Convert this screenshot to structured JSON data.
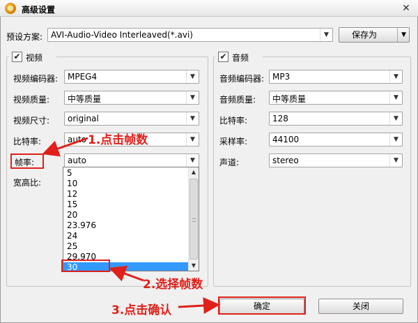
{
  "window": {
    "title": "高级设置",
    "close_glyph": "✕"
  },
  "preset": {
    "label": "预设方案:",
    "value": "AVI-Audio-Video Interleaved(*.avi)",
    "save_as_label": "保存为"
  },
  "video": {
    "title": "视频",
    "checked": true,
    "fields": {
      "encoder": {
        "label": "视频编码器:",
        "value": "MPEG4"
      },
      "quality": {
        "label": "视频质量:",
        "value": "中等质量"
      },
      "size": {
        "label": "视频尺寸:",
        "value": "original"
      },
      "bitrate": {
        "label": "比特率:",
        "value": "auto"
      },
      "framerate": {
        "label": "帧率:",
        "value": "auto"
      },
      "aspect": {
        "label": "宽高比:"
      }
    },
    "framerate_options": [
      "5",
      "10",
      "12",
      "15",
      "20",
      "23.976",
      "24",
      "25",
      "29.970",
      "30"
    ],
    "framerate_selected": "30"
  },
  "audio": {
    "title": "音频",
    "checked": true,
    "fields": {
      "encoder": {
        "label": "音频编码器:",
        "value": "MP3"
      },
      "quality": {
        "label": "音频质量:",
        "value": "中等质量"
      },
      "bitrate": {
        "label": "比特率:",
        "value": "128"
      },
      "samplerate": {
        "label": "采样率:",
        "value": "44100"
      },
      "channel": {
        "label": "声道:",
        "value": "stereo"
      }
    }
  },
  "buttons": {
    "ok_label": "确定",
    "close_label": "关闭"
  },
  "annotations": {
    "step1": "1.点击帧数",
    "step2": "2.选择帧数",
    "step3": "3.点击确认",
    "color": "#e0201a"
  },
  "icons": {
    "checkbox_mark": "✔",
    "dropdown_arrow": "▼",
    "scroll_up": "▲",
    "scroll_down": "▼"
  },
  "colors": {
    "selection": "#3399ff",
    "background": "#f0f0f0"
  }
}
